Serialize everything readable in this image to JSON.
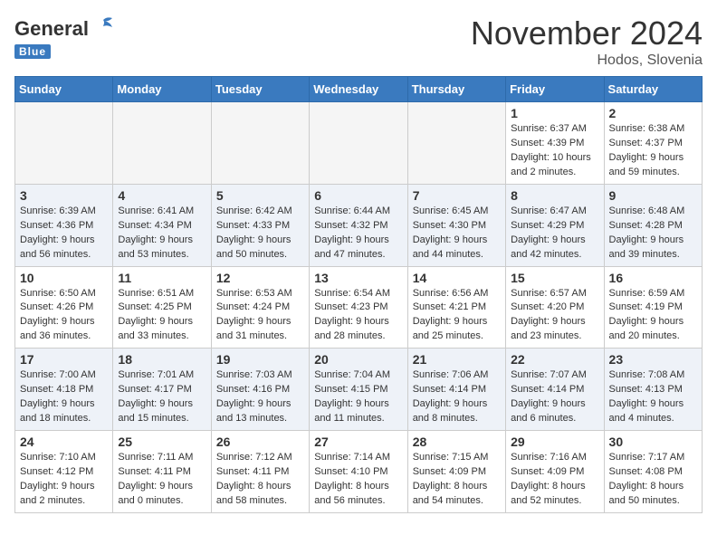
{
  "header": {
    "logo_general": "General",
    "logo_blue": "Blue",
    "month_title": "November 2024",
    "location": "Hodos, Slovenia"
  },
  "days_of_week": [
    "Sunday",
    "Monday",
    "Tuesday",
    "Wednesday",
    "Thursday",
    "Friday",
    "Saturday"
  ],
  "weeks": [
    [
      {
        "day": null,
        "info": null
      },
      {
        "day": null,
        "info": null
      },
      {
        "day": null,
        "info": null
      },
      {
        "day": null,
        "info": null
      },
      {
        "day": null,
        "info": null
      },
      {
        "day": "1",
        "info": "Sunrise: 6:37 AM\nSunset: 4:39 PM\nDaylight: 10 hours and 2 minutes."
      },
      {
        "day": "2",
        "info": "Sunrise: 6:38 AM\nSunset: 4:37 PM\nDaylight: 9 hours and 59 minutes."
      }
    ],
    [
      {
        "day": "3",
        "info": "Sunrise: 6:39 AM\nSunset: 4:36 PM\nDaylight: 9 hours and 56 minutes."
      },
      {
        "day": "4",
        "info": "Sunrise: 6:41 AM\nSunset: 4:34 PM\nDaylight: 9 hours and 53 minutes."
      },
      {
        "day": "5",
        "info": "Sunrise: 6:42 AM\nSunset: 4:33 PM\nDaylight: 9 hours and 50 minutes."
      },
      {
        "day": "6",
        "info": "Sunrise: 6:44 AM\nSunset: 4:32 PM\nDaylight: 9 hours and 47 minutes."
      },
      {
        "day": "7",
        "info": "Sunrise: 6:45 AM\nSunset: 4:30 PM\nDaylight: 9 hours and 44 minutes."
      },
      {
        "day": "8",
        "info": "Sunrise: 6:47 AM\nSunset: 4:29 PM\nDaylight: 9 hours and 42 minutes."
      },
      {
        "day": "9",
        "info": "Sunrise: 6:48 AM\nSunset: 4:28 PM\nDaylight: 9 hours and 39 minutes."
      }
    ],
    [
      {
        "day": "10",
        "info": "Sunrise: 6:50 AM\nSunset: 4:26 PM\nDaylight: 9 hours and 36 minutes."
      },
      {
        "day": "11",
        "info": "Sunrise: 6:51 AM\nSunset: 4:25 PM\nDaylight: 9 hours and 33 minutes."
      },
      {
        "day": "12",
        "info": "Sunrise: 6:53 AM\nSunset: 4:24 PM\nDaylight: 9 hours and 31 minutes."
      },
      {
        "day": "13",
        "info": "Sunrise: 6:54 AM\nSunset: 4:23 PM\nDaylight: 9 hours and 28 minutes."
      },
      {
        "day": "14",
        "info": "Sunrise: 6:56 AM\nSunset: 4:21 PM\nDaylight: 9 hours and 25 minutes."
      },
      {
        "day": "15",
        "info": "Sunrise: 6:57 AM\nSunset: 4:20 PM\nDaylight: 9 hours and 23 minutes."
      },
      {
        "day": "16",
        "info": "Sunrise: 6:59 AM\nSunset: 4:19 PM\nDaylight: 9 hours and 20 minutes."
      }
    ],
    [
      {
        "day": "17",
        "info": "Sunrise: 7:00 AM\nSunset: 4:18 PM\nDaylight: 9 hours and 18 minutes."
      },
      {
        "day": "18",
        "info": "Sunrise: 7:01 AM\nSunset: 4:17 PM\nDaylight: 9 hours and 15 minutes."
      },
      {
        "day": "19",
        "info": "Sunrise: 7:03 AM\nSunset: 4:16 PM\nDaylight: 9 hours and 13 minutes."
      },
      {
        "day": "20",
        "info": "Sunrise: 7:04 AM\nSunset: 4:15 PM\nDaylight: 9 hours and 11 minutes."
      },
      {
        "day": "21",
        "info": "Sunrise: 7:06 AM\nSunset: 4:14 PM\nDaylight: 9 hours and 8 minutes."
      },
      {
        "day": "22",
        "info": "Sunrise: 7:07 AM\nSunset: 4:14 PM\nDaylight: 9 hours and 6 minutes."
      },
      {
        "day": "23",
        "info": "Sunrise: 7:08 AM\nSunset: 4:13 PM\nDaylight: 9 hours and 4 minutes."
      }
    ],
    [
      {
        "day": "24",
        "info": "Sunrise: 7:10 AM\nSunset: 4:12 PM\nDaylight: 9 hours and 2 minutes."
      },
      {
        "day": "25",
        "info": "Sunrise: 7:11 AM\nSunset: 4:11 PM\nDaylight: 9 hours and 0 minutes."
      },
      {
        "day": "26",
        "info": "Sunrise: 7:12 AM\nSunset: 4:11 PM\nDaylight: 8 hours and 58 minutes."
      },
      {
        "day": "27",
        "info": "Sunrise: 7:14 AM\nSunset: 4:10 PM\nDaylight: 8 hours and 56 minutes."
      },
      {
        "day": "28",
        "info": "Sunrise: 7:15 AM\nSunset: 4:09 PM\nDaylight: 8 hours and 54 minutes."
      },
      {
        "day": "29",
        "info": "Sunrise: 7:16 AM\nSunset: 4:09 PM\nDaylight: 8 hours and 52 minutes."
      },
      {
        "day": "30",
        "info": "Sunrise: 7:17 AM\nSunset: 4:08 PM\nDaylight: 8 hours and 50 minutes."
      }
    ]
  ]
}
